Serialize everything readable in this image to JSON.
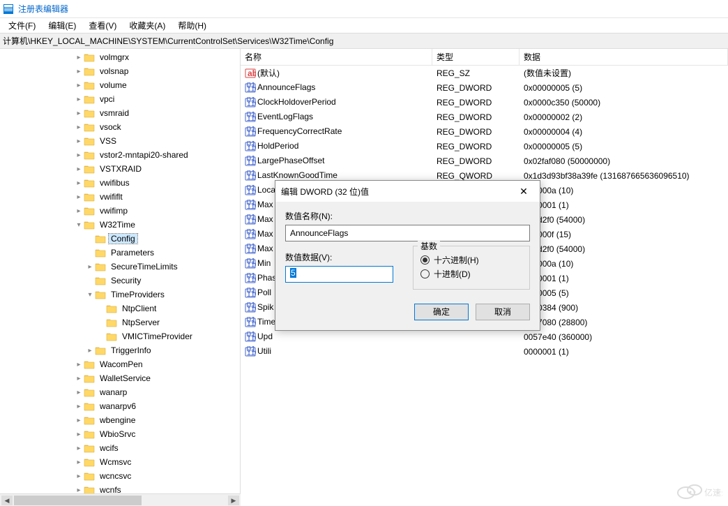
{
  "window": {
    "title": "注册表编辑器"
  },
  "menu": {
    "file": "文件(F)",
    "edit": "编辑(E)",
    "view": "查看(V)",
    "favorites": "收藏夹(A)",
    "help": "帮助(H)"
  },
  "address": {
    "prefix": "计算机",
    "path": "\\HKEY_LOCAL_MACHINE\\SYSTEM\\CurrentControlSet\\Services\\W32Time\\Config"
  },
  "tree": {
    "items": [
      {
        "label": "volmgrx",
        "indent": 7,
        "exp": ">"
      },
      {
        "label": "volsnap",
        "indent": 7,
        "exp": ">"
      },
      {
        "label": "volume",
        "indent": 7,
        "exp": ">"
      },
      {
        "label": "vpci",
        "indent": 7,
        "exp": ">"
      },
      {
        "label": "vsmraid",
        "indent": 7,
        "exp": ">"
      },
      {
        "label": "vsock",
        "indent": 7,
        "exp": ">"
      },
      {
        "label": "VSS",
        "indent": 7,
        "exp": ">"
      },
      {
        "label": "vstor2-mntapi20-shared",
        "indent": 7,
        "exp": ">"
      },
      {
        "label": "VSTXRAID",
        "indent": 7,
        "exp": ">"
      },
      {
        "label": "vwifibus",
        "indent": 7,
        "exp": ">"
      },
      {
        "label": "vwififlt",
        "indent": 7,
        "exp": ">"
      },
      {
        "label": "vwifimp",
        "indent": 7,
        "exp": ">"
      },
      {
        "label": "W32Time",
        "indent": 7,
        "exp": "v"
      },
      {
        "label": "Config",
        "indent": 8,
        "exp": "",
        "selected": true
      },
      {
        "label": "Parameters",
        "indent": 8,
        "exp": ""
      },
      {
        "label": "SecureTimeLimits",
        "indent": 8,
        "exp": ">"
      },
      {
        "label": "Security",
        "indent": 8,
        "exp": ""
      },
      {
        "label": "TimeProviders",
        "indent": 8,
        "exp": "v"
      },
      {
        "label": "NtpClient",
        "indent": 9,
        "exp": ""
      },
      {
        "label": "NtpServer",
        "indent": 9,
        "exp": ""
      },
      {
        "label": "VMICTimeProvider",
        "indent": 9,
        "exp": ""
      },
      {
        "label": "TriggerInfo",
        "indent": 8,
        "exp": ">"
      },
      {
        "label": "WacomPen",
        "indent": 7,
        "exp": ">"
      },
      {
        "label": "WalletService",
        "indent": 7,
        "exp": ">"
      },
      {
        "label": "wanarp",
        "indent": 7,
        "exp": ">"
      },
      {
        "label": "wanarpv6",
        "indent": 7,
        "exp": ">"
      },
      {
        "label": "wbengine",
        "indent": 7,
        "exp": ">"
      },
      {
        "label": "WbioSrvc",
        "indent": 7,
        "exp": ">"
      },
      {
        "label": "wcifs",
        "indent": 7,
        "exp": ">"
      },
      {
        "label": "Wcmsvc",
        "indent": 7,
        "exp": ">"
      },
      {
        "label": "wcncsvc",
        "indent": 7,
        "exp": ">"
      },
      {
        "label": "wcnfs",
        "indent": 7,
        "exp": ">"
      }
    ]
  },
  "list": {
    "headers": {
      "name": "名称",
      "type": "类型",
      "data": "数据"
    },
    "rows": [
      {
        "icon": "str",
        "name": "(默认)",
        "type": "REG_SZ",
        "data": "(数值未设置)"
      },
      {
        "icon": "bin",
        "name": "AnnounceFlags",
        "type": "REG_DWORD",
        "data": "0x00000005 (5)"
      },
      {
        "icon": "bin",
        "name": "ClockHoldoverPeriod",
        "type": "REG_DWORD",
        "data": "0x0000c350 (50000)"
      },
      {
        "icon": "bin",
        "name": "EventLogFlags",
        "type": "REG_DWORD",
        "data": "0x00000002 (2)"
      },
      {
        "icon": "bin",
        "name": "FrequencyCorrectRate",
        "type": "REG_DWORD",
        "data": "0x00000004 (4)"
      },
      {
        "icon": "bin",
        "name": "HoldPeriod",
        "type": "REG_DWORD",
        "data": "0x00000005 (5)"
      },
      {
        "icon": "bin",
        "name": "LargePhaseOffset",
        "type": "REG_DWORD",
        "data": "0x02faf080 (50000000)"
      },
      {
        "icon": "bin",
        "name": "LastKnownGoodTime",
        "type": "REG_QWORD",
        "data": "0x1d3d93bf38a39fe (131687665636096510)"
      },
      {
        "icon": "bin",
        "name": "Loca",
        "type": "",
        "data": "000000a (10)"
      },
      {
        "icon": "bin",
        "name": "Max",
        "type": "",
        "data": "0000001 (1)"
      },
      {
        "icon": "bin",
        "name": "Max",
        "type": "",
        "data": "000d2f0 (54000)"
      },
      {
        "icon": "bin",
        "name": "Max",
        "type": "",
        "data": "000000f (15)"
      },
      {
        "icon": "bin",
        "name": "Max",
        "type": "",
        "data": "000d2f0 (54000)"
      },
      {
        "icon": "bin",
        "name": "Min",
        "type": "",
        "data": "000000a (10)"
      },
      {
        "icon": "bin",
        "name": "Phas",
        "type": "",
        "data": "0000001 (1)"
      },
      {
        "icon": "bin",
        "name": "Poll",
        "type": "",
        "data": "0000005 (5)"
      },
      {
        "icon": "bin",
        "name": "Spik",
        "type": "",
        "data": "0000384 (900)"
      },
      {
        "icon": "bin",
        "name": "Time",
        "type": "",
        "data": "0007080 (28800)"
      },
      {
        "icon": "bin",
        "name": "Upd",
        "type": "",
        "data": "0057e40 (360000)"
      },
      {
        "icon": "bin",
        "name": "Utili",
        "type": "",
        "data": "0000001 (1)"
      }
    ]
  },
  "dialog": {
    "title": "编辑 DWORD (32 位)值",
    "name_label": "数值名称(N):",
    "name_value": "AnnounceFlags",
    "data_label": "数值数据(V):",
    "data_value": "5",
    "base_label": "基数",
    "radio_hex": "十六进制(H)",
    "radio_dec": "十进制(D)",
    "ok": "确定",
    "cancel": "取消"
  },
  "watermark": "亿速云"
}
